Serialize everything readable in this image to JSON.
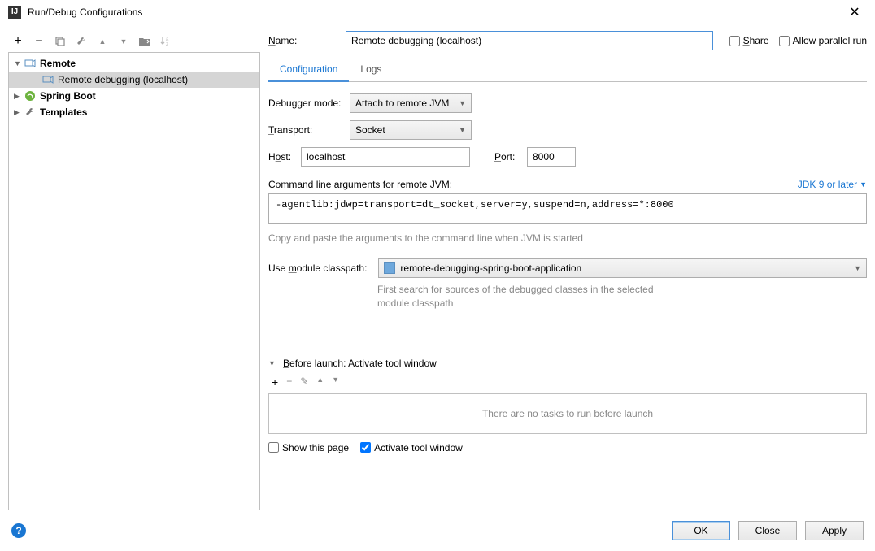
{
  "titlebar": {
    "title": "Run/Debug Configurations"
  },
  "toolbar": {
    "add": "+",
    "remove": "−",
    "copy": "⧉",
    "edit": "🔧",
    "up": "▲",
    "down": "▼",
    "folder": "📁",
    "sort": "↓ª"
  },
  "tree": {
    "items": [
      {
        "label": "Remote",
        "icon": "remote",
        "bold": true,
        "expanded": true,
        "children": [
          {
            "label": "Remote debugging (localhost)",
            "icon": "remote",
            "selected": true
          }
        ]
      },
      {
        "label": "Spring Boot",
        "icon": "spring",
        "bold": true,
        "expanded": false
      },
      {
        "label": "Templates",
        "icon": "wrench",
        "bold": true,
        "expanded": false
      }
    ]
  },
  "form": {
    "name_label": "Name:",
    "name_value": "Remote debugging (localhost)",
    "share_label": "Share",
    "parallel_label": "Allow parallel run",
    "tabs": {
      "config": "Configuration",
      "logs": "Logs"
    },
    "debugger_mode_label": "Debugger mode:",
    "debugger_mode_value": "Attach to remote JVM",
    "transport_label": "Transport:",
    "transport_value": "Socket",
    "host_label": "Host:",
    "host_value": "localhost",
    "port_label": "Port:",
    "port_value": "8000",
    "cmd_label": "Command line arguments for remote JVM:",
    "jdk_label": "JDK 9 or later",
    "cmd_value": "-agentlib:jdwp=transport=dt_socket,server=y,suspend=n,address=*:8000",
    "copy_hint": "Copy and paste the arguments to the command line when JVM is started",
    "module_label": "Use module classpath:",
    "module_value": "remote-debugging-spring-boot-application",
    "module_hint1": "First search for sources of the debugged classes in the selected",
    "module_hint2": "module classpath",
    "before_label": "Before launch: Activate tool window",
    "tasks_empty": "There are no tasks to run before launch",
    "show_page": "Show this page",
    "activate_tool": "Activate tool window"
  },
  "footer": {
    "ok": "OK",
    "close": "Close",
    "apply": "Apply"
  }
}
